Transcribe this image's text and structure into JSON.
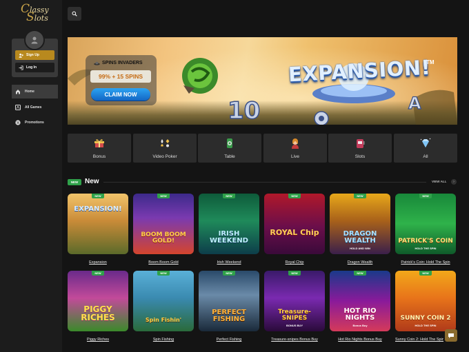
{
  "brand": {
    "logo_line1": "lassy",
    "logo_line2": "lots",
    "logo_initial1": "C",
    "logo_initial2": "S"
  },
  "user": {
    "signup_label": "Sign Up",
    "login_label": "Log In"
  },
  "nav": [
    {
      "label": "Home",
      "icon": "home-icon",
      "active": true
    },
    {
      "label": "All Games",
      "icon": "grid-icon",
      "active": false
    },
    {
      "label": "Promotions",
      "icon": "percent-icon",
      "active": false
    }
  ],
  "search": {
    "icon": "search-icon"
  },
  "banner": {
    "promo_title": "SPINS INVADERS",
    "promo_offer": "99% + 15 SPINS",
    "cta": "CLAIM NOW",
    "game_logo": "EXPANSION!",
    "tm": "TM"
  },
  "categories": [
    {
      "label": "Bonus",
      "icon": "gift-icon"
    },
    {
      "label": "Video Poker",
      "icon": "cards-icon"
    },
    {
      "label": "Table",
      "icon": "chips-icon"
    },
    {
      "label": "Live",
      "icon": "dealer-icon"
    },
    {
      "label": "Slots",
      "icon": "slot-machine-icon"
    },
    {
      "label": "All",
      "icon": "diamond-icon"
    }
  ],
  "section": {
    "badge": "NEW",
    "title": "New",
    "view_all": "VIEW ALL",
    "view_all_arrow": "›"
  },
  "games": [
    {
      "title": "Expansion",
      "art": "EXPANSION!",
      "sub": "",
      "badge": "NEW"
    },
    {
      "title": "Boom Boom Gold",
      "art": "BOOM BOOM GOLD!",
      "sub": "",
      "badge": "NEW"
    },
    {
      "title": "Irish Weekend",
      "art": "IRISH WEEKEND",
      "sub": "",
      "badge": "NEW"
    },
    {
      "title": "Royal Chip",
      "art": "ROYAL Chip",
      "sub": "",
      "badge": "NEW"
    },
    {
      "title": "Dragon Wealth",
      "art": "DRAGON WEALTH",
      "sub": "HOLD AND WIN",
      "badge": "NEW"
    },
    {
      "title": "Patrick's Coin: Hold The Spin",
      "art": "PATRICK'S COIN",
      "sub": "HOLD THE SPIN",
      "badge": "NEW"
    },
    {
      "title": "Piggy Riches",
      "art": "PIGGY RICHES",
      "sub": "",
      "badge": "NEW"
    },
    {
      "title": "Spin Fishing",
      "art": "Spin Fishin'",
      "sub": "",
      "badge": "NEW"
    },
    {
      "title": "Perfect Fishing",
      "art": "PERFECT FISHING",
      "sub": "",
      "badge": "NEW"
    },
    {
      "title": "Treasure-snipes Bonus Buy",
      "art": "Treasure-SNIPES",
      "sub": "BONUS BUY",
      "badge": "NEW"
    },
    {
      "title": "Hot Rio Nights Bonus Buy",
      "art": "HOT RIO NIGHTS",
      "sub": "Bonus Buy",
      "badge": "NEW"
    },
    {
      "title": "Sunny Coin 2: Hold The Spin",
      "art": "SUNNY COIN 2",
      "sub": "HOLD THE SPIN",
      "badge": "NEW"
    }
  ],
  "colors": {
    "accent_gold": "#b8891e",
    "badge_green": "#2fa14a",
    "bg": "#141414",
    "sidebar": "#1c1c1c"
  },
  "chat": {
    "icon": "chat-icon"
  }
}
